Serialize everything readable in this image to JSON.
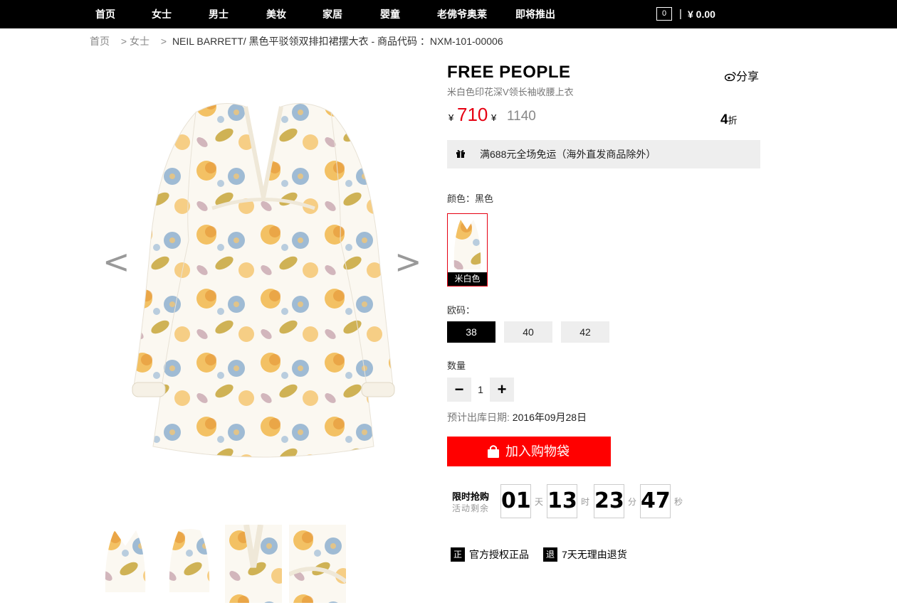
{
  "nav": {
    "items": [
      "首页",
      "女士",
      "男士",
      "美妆",
      "家居",
      "婴童",
      "老佛爷奥莱",
      "即将推出"
    ],
    "cart_count": "0",
    "cart_separator": "|",
    "cart_total": "¥ 0.00"
  },
  "breadcrumb": {
    "home": "首页",
    "sep1": ">",
    "category": "女士",
    "sep2": ">",
    "product": "NEIL BARRETT/ 黑色平驳领双排扣裙摆大衣 - 商品代码 ：NXM-101-00006"
  },
  "gallery": {
    "prev": "<",
    "next": ">",
    "thumb_count": 4
  },
  "product": {
    "brand": "FREE PEOPLE",
    "share": "分享",
    "subtitle": "米白色印花深V领长袖收腰上衣",
    "currency": "¥",
    "price": "710",
    "original_price": "1140",
    "discount": "4",
    "discount_unit": "折",
    "promo": "满688元全场免运（海外直发商品除外）",
    "color_label": "颜色：黑色",
    "color_option": "米白色",
    "size_label": "欧码：",
    "sizes": [
      "38",
      "40",
      "42"
    ],
    "selected_size": "38",
    "qty_label": "数量",
    "qty_minus": "−",
    "qty": "1",
    "qty_plus": "+",
    "ship_label": "预计出库日期:",
    "ship_date": "2016年09月28日",
    "add_to_cart": "加入购物袋"
  },
  "countdown": {
    "title": "限时抢购",
    "subtitle": "活动剩余",
    "days": "01",
    "days_unit": "天",
    "hours": "13",
    "hours_unit": "时",
    "minutes": "23",
    "minutes_unit": "分",
    "seconds": "47",
    "seconds_unit": "秒"
  },
  "guarantees": [
    {
      "badge": "正",
      "text": "官方授权正品"
    },
    {
      "badge": "退",
      "text": "7天无理由退货"
    }
  ],
  "colors": {
    "nav_bg": "#000000",
    "price_red": "#e60012",
    "button_red": "#ff0000"
  }
}
